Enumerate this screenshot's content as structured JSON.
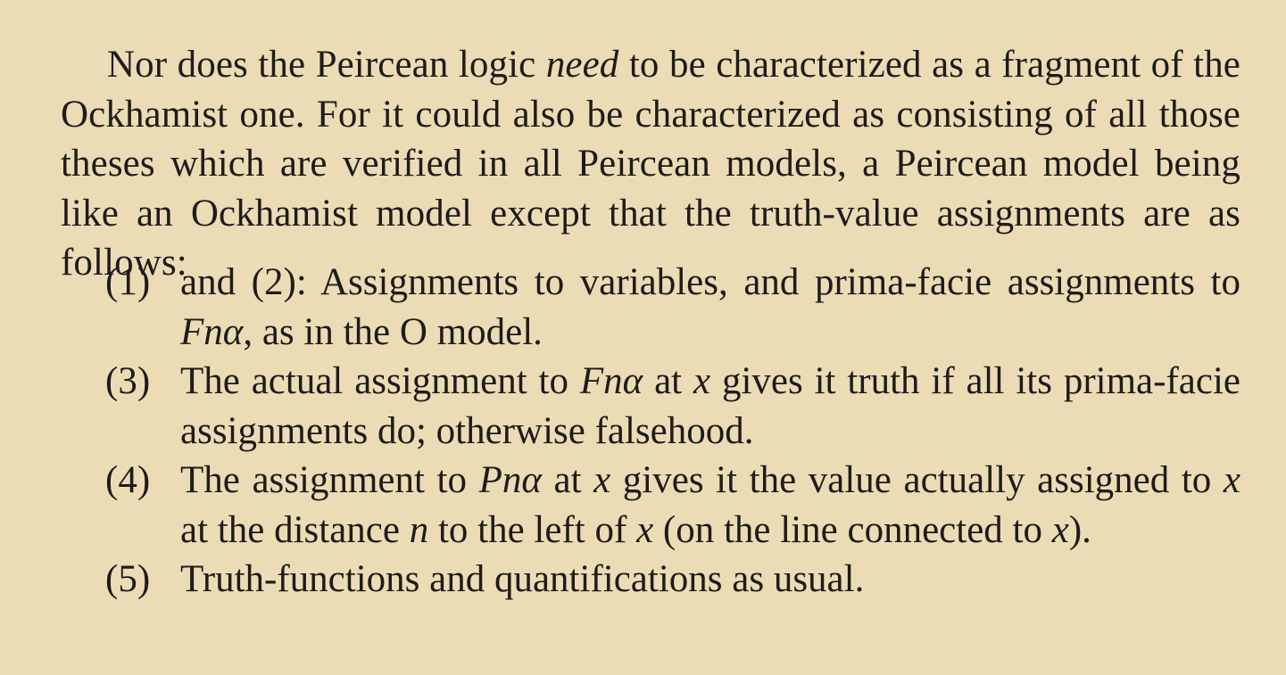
{
  "paragraph": {
    "part1": "Nor does the Peircean logic ",
    "emphasis": "need",
    "part2": " to be characterized as a fragment of the Ockhamist one. For it could also be characterized as consisting of all those theses which are verified in all Peircean models, a Peircean model being like an Ockhamist model except that the truth-value assignments are as follows:"
  },
  "items": [
    {
      "num": "(1)",
      "a": "and (2): Assignments to variables, and prima-facie assignments to ",
      "b": "Fnα",
      "c": ", as in the O model."
    },
    {
      "num": "(3)",
      "a": "The actual assignment to ",
      "b": "Fnα",
      "c": " at ",
      "d": "x",
      "e": " gives it truth if all its prima-facie assignments do; otherwise falsehood."
    },
    {
      "num": "(4)",
      "a": "The assignment to ",
      "b": "Pnα",
      "c": " at ",
      "d": "x",
      "e": " gives it the value actually assigned to ",
      "f": "x",
      "g": " at the distance ",
      "h": "n",
      "i": " to the left of ",
      "j": "x",
      "k": " (on the line connected to ",
      "l": "x",
      "m": ")."
    },
    {
      "num": "(5)",
      "a": "Truth-functions and quantifications as usual."
    }
  ]
}
